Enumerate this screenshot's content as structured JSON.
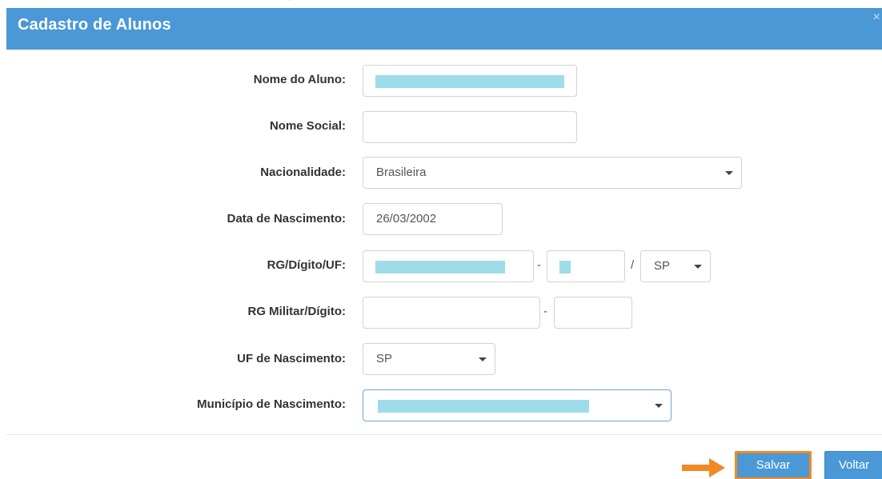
{
  "modal": {
    "title": "Cadastro de Alunos",
    "close_label": "×"
  },
  "form": {
    "nome_aluno": {
      "label": "Nome do Aluno:",
      "value": ""
    },
    "nome_social": {
      "label": "Nome Social:",
      "value": ""
    },
    "nacionalidade": {
      "label": "Nacionalidade:",
      "value": "Brasileira"
    },
    "data_nascimento": {
      "label": "Data de Nascimento:",
      "value": "26/03/2002"
    },
    "rg": {
      "label": "RG/Dígito/UF:",
      "separator_dash": "-",
      "separator_slash": "/",
      "uf_value": "SP"
    },
    "rg_militar": {
      "label": "RG Militar/Dígito:",
      "separator_dash": "-"
    },
    "uf_nascimento": {
      "label": "UF de Nascimento:",
      "value": "SP"
    },
    "municipio_nascimento": {
      "label": "Município de Nascimento:",
      "value": ""
    }
  },
  "footer": {
    "save_label": "Salvar",
    "back_label": "Voltar"
  },
  "colors": {
    "header": "#4a98d6",
    "highlight": "#f08a24",
    "redaction": "#9fdcea"
  },
  "icons": {
    "caret": "chevron-down-icon",
    "arrow": "arrow-right-icon"
  }
}
